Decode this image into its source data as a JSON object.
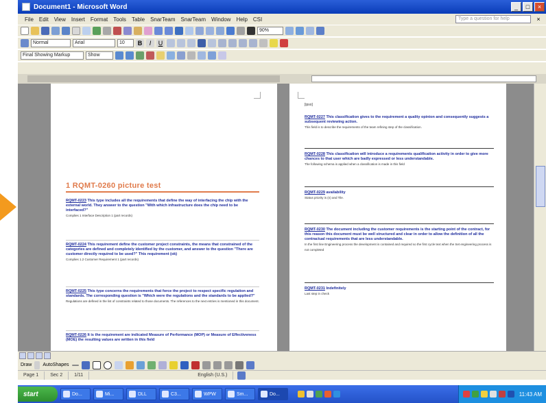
{
  "window": {
    "title": "Document1 - Microsoft Word"
  },
  "menu": {
    "items": [
      "File",
      "Edit",
      "View",
      "Insert",
      "Format",
      "Tools",
      "Table",
      "SnarTeam",
      "SnarTeam",
      "Window",
      "Help",
      "CSI"
    ],
    "help_placeholder": "Type a question for help"
  },
  "toolbar": {
    "zoom": "90%",
    "style": "Normal",
    "font": "Arial",
    "size": "10",
    "markup": "Final Showing Markup",
    "show": "Show"
  },
  "document": {
    "left_page": {
      "heading": "1 RQMT-0260 picture test",
      "requirements": [
        {
          "id": "RQMT-0223",
          "text": "This type includes all the requirements that define the way of interfacing the chip with the external world. They answer to the question \"With which infrastructure does the chip need to be interfaced?\"",
          "note": "Complies 1 Interface Description 1 (part records)"
        },
        {
          "id": "RQMT-0224",
          "text": "This requirement define the customer project constraints, the means that constrained of the categories are defined and completely identified by the customer, and answer to the question \"There are customer directly required to be used?\" This requirement (ok)",
          "note": "Complies 1.2 Customer Requirement 1 (part records)"
        },
        {
          "id": "RQMT-0225",
          "text": "This type concerns the requirements that force the project to respect specific regulation and standards. The corresponding question is \"Which were the regulations and the standards to be applied?\"",
          "note": "Regulations are defined in the list of constraints related to those documents. The references to the next entries is mentioned in this document."
        },
        {
          "id": "RQMT-0226",
          "text": "It is the requirement are indicated Measure of Performance (MOP) or Measure of Effectiveness (MOE) the resulting values are written in this field",
          "note": ""
        }
      ]
    },
    "right_page": {
      "top_label": "[ipso]",
      "requirements": [
        {
          "id": "RQMT-0227",
          "text": "This classification gives to the requirement a quality opinion and consequently suggests a subsequent reviewing action.",
          "note": "This field is to describe the requirements of the team refining step of the classification."
        },
        {
          "id": "RQMT-0228",
          "text": "This classification will introduce a requirements qualification activity in order to give more chances to that user which are badly expressed or less understandable.",
          "note": "The following schema is applied when a classification is made in this field"
        },
        {
          "id": "RQMT-0229",
          "text": "availability",
          "note": "Status priority is (n) and Tile."
        },
        {
          "id": "RQMT-0230",
          "text": "The document including the customer requirements is the starting point of the contract, for this reason this document must be well structured and clear in order to allow the definition of all the contractual requirements that are less understandable.",
          "note": "In the first line Engineering process the development is contained and required so the first cycle text when the Set engineering process is not completed"
        },
        {
          "id": "RQMT-0231",
          "text": "Indefinitely",
          "note": "Last step in check"
        }
      ]
    }
  },
  "drawing": {
    "draw_label": "Draw",
    "autoshapes_label": "AutoShapes"
  },
  "status": {
    "page": "Page 1",
    "sec": "Sec 2",
    "position": "1/11",
    "language": "English (U.S.)"
  },
  "taskbar": {
    "start_label": "start",
    "tasks": [
      "Do...",
      "Mi...",
      "DLL",
      "C3...",
      "WPW",
      "Sm...",
      "Do..."
    ],
    "clock": "11:43 AM"
  },
  "colors": {
    "titlebar": "#0a3cb8",
    "requirement_text": "#1c2a9c",
    "heading": "#e07a4a",
    "arrow": "#f39a1e",
    "taskbar": "#2452c8"
  }
}
